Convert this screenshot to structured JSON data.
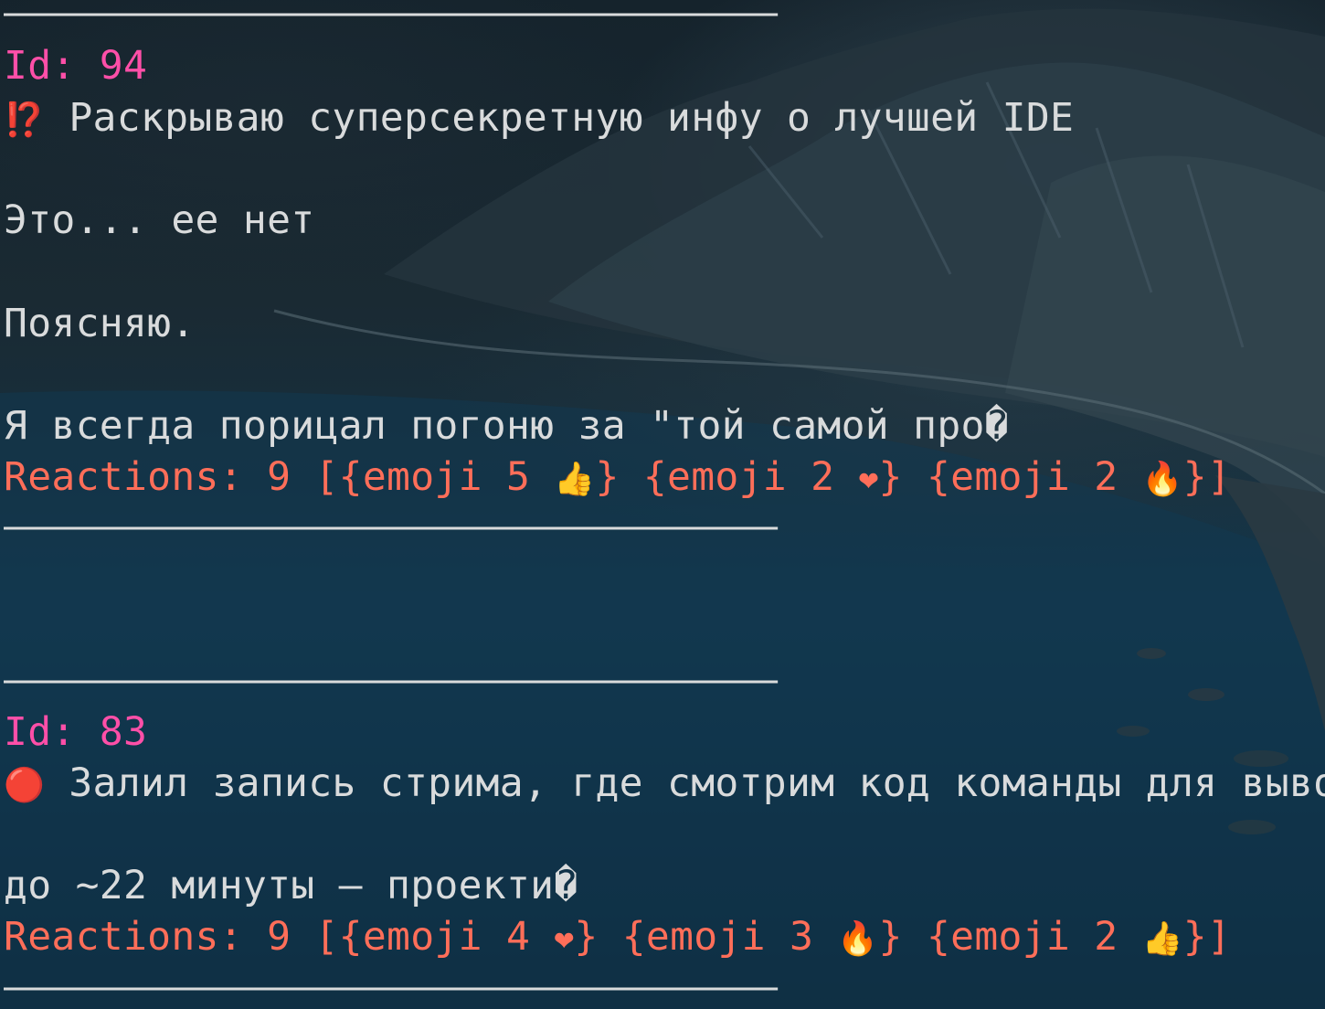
{
  "separator": "——————————————————————————————————",
  "posts": [
    {
      "id_label": "Id: 94",
      "title_icon": "⁉️",
      "title": "Раскрываю суперсекретную инфу о лучшей IDE",
      "line2": "Это... ее нет",
      "line3": "Поясняю.",
      "line4": "Я всегда порицал погоню за \"той самой про�",
      "reactions_prefix": "Reactions: 9 [",
      "reactions": [
        {
          "text": "{emoji 5 ",
          "emoji": "👍",
          "close": "}"
        },
        {
          "text": " {emoji 2 ",
          "emoji": "❤",
          "close": "}"
        },
        {
          "text": " {emoji 2 ",
          "emoji": "🔥",
          "close": "}"
        }
      ],
      "reactions_suffix": "]"
    },
    {
      "id_label": "Id: 83",
      "title_icon": "🔴",
      "title": "Залил запись стрима, где смотрим код команды для выво",
      "line2": "до ~22 минуты – проекти�",
      "reactions_prefix": "Reactions: 9 [",
      "reactions": [
        {
          "text": "{emoji 4 ",
          "emoji": "❤",
          "close": "}"
        },
        {
          "text": " {emoji 3 ",
          "emoji": "🔥",
          "close": "}"
        },
        {
          "text": " {emoji 2 ",
          "emoji": "👍",
          "close": "}"
        }
      ],
      "reactions_suffix": "]"
    }
  ],
  "colors": {
    "text": "#d9dbdc",
    "id": "#ff4fa8",
    "reactions": "#ff6e59"
  }
}
